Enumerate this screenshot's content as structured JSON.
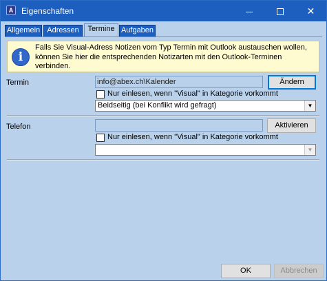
{
  "window": {
    "title": "Eigenschaften",
    "app_icon_glyph": "A",
    "minimize_icon": "minimize-icon",
    "maximize_icon": "maximize-icon",
    "close_glyph": "✕"
  },
  "tabs": [
    {
      "label": "Allgemein",
      "active": false
    },
    {
      "label": "Adressen",
      "active": false
    },
    {
      "label": "Termine",
      "active": true
    },
    {
      "label": "Aufgaben",
      "active": false
    }
  ],
  "info": {
    "icon_glyph": "i",
    "text": "Falls Sie Visual-Adress Notizen vom Typ Termin mit Outlook austauschen wollen, können Sie hier die entsprechenden Notizarten mit den Outlook-Terminen verbinden."
  },
  "termin": {
    "label": "Termin",
    "field_value": "info@abex.ch\\Kalender",
    "button_label": "Ändern",
    "checkbox_label": "Nur einlesen, wenn \"Visual\" in Kategorie vorkommt",
    "checkbox_checked": false,
    "select_value": "Beidseitig  (bei Konflikt wird gefragt)"
  },
  "telefon": {
    "label": "Telefon",
    "field_value": "",
    "button_label": "Aktivieren",
    "checkbox_label": "Nur einlesen, wenn \"Visual\" in Kategorie vorkommt",
    "checkbox_checked": false,
    "select_value": ""
  },
  "footer": {
    "ok_label": "OK",
    "cancel_label": "Abbrechen"
  },
  "colors": {
    "titlebar": "#1c5fbf",
    "window_bg": "#b9d1ea",
    "info_bg": "#fffbd0",
    "info_icon": "#3067c9"
  }
}
